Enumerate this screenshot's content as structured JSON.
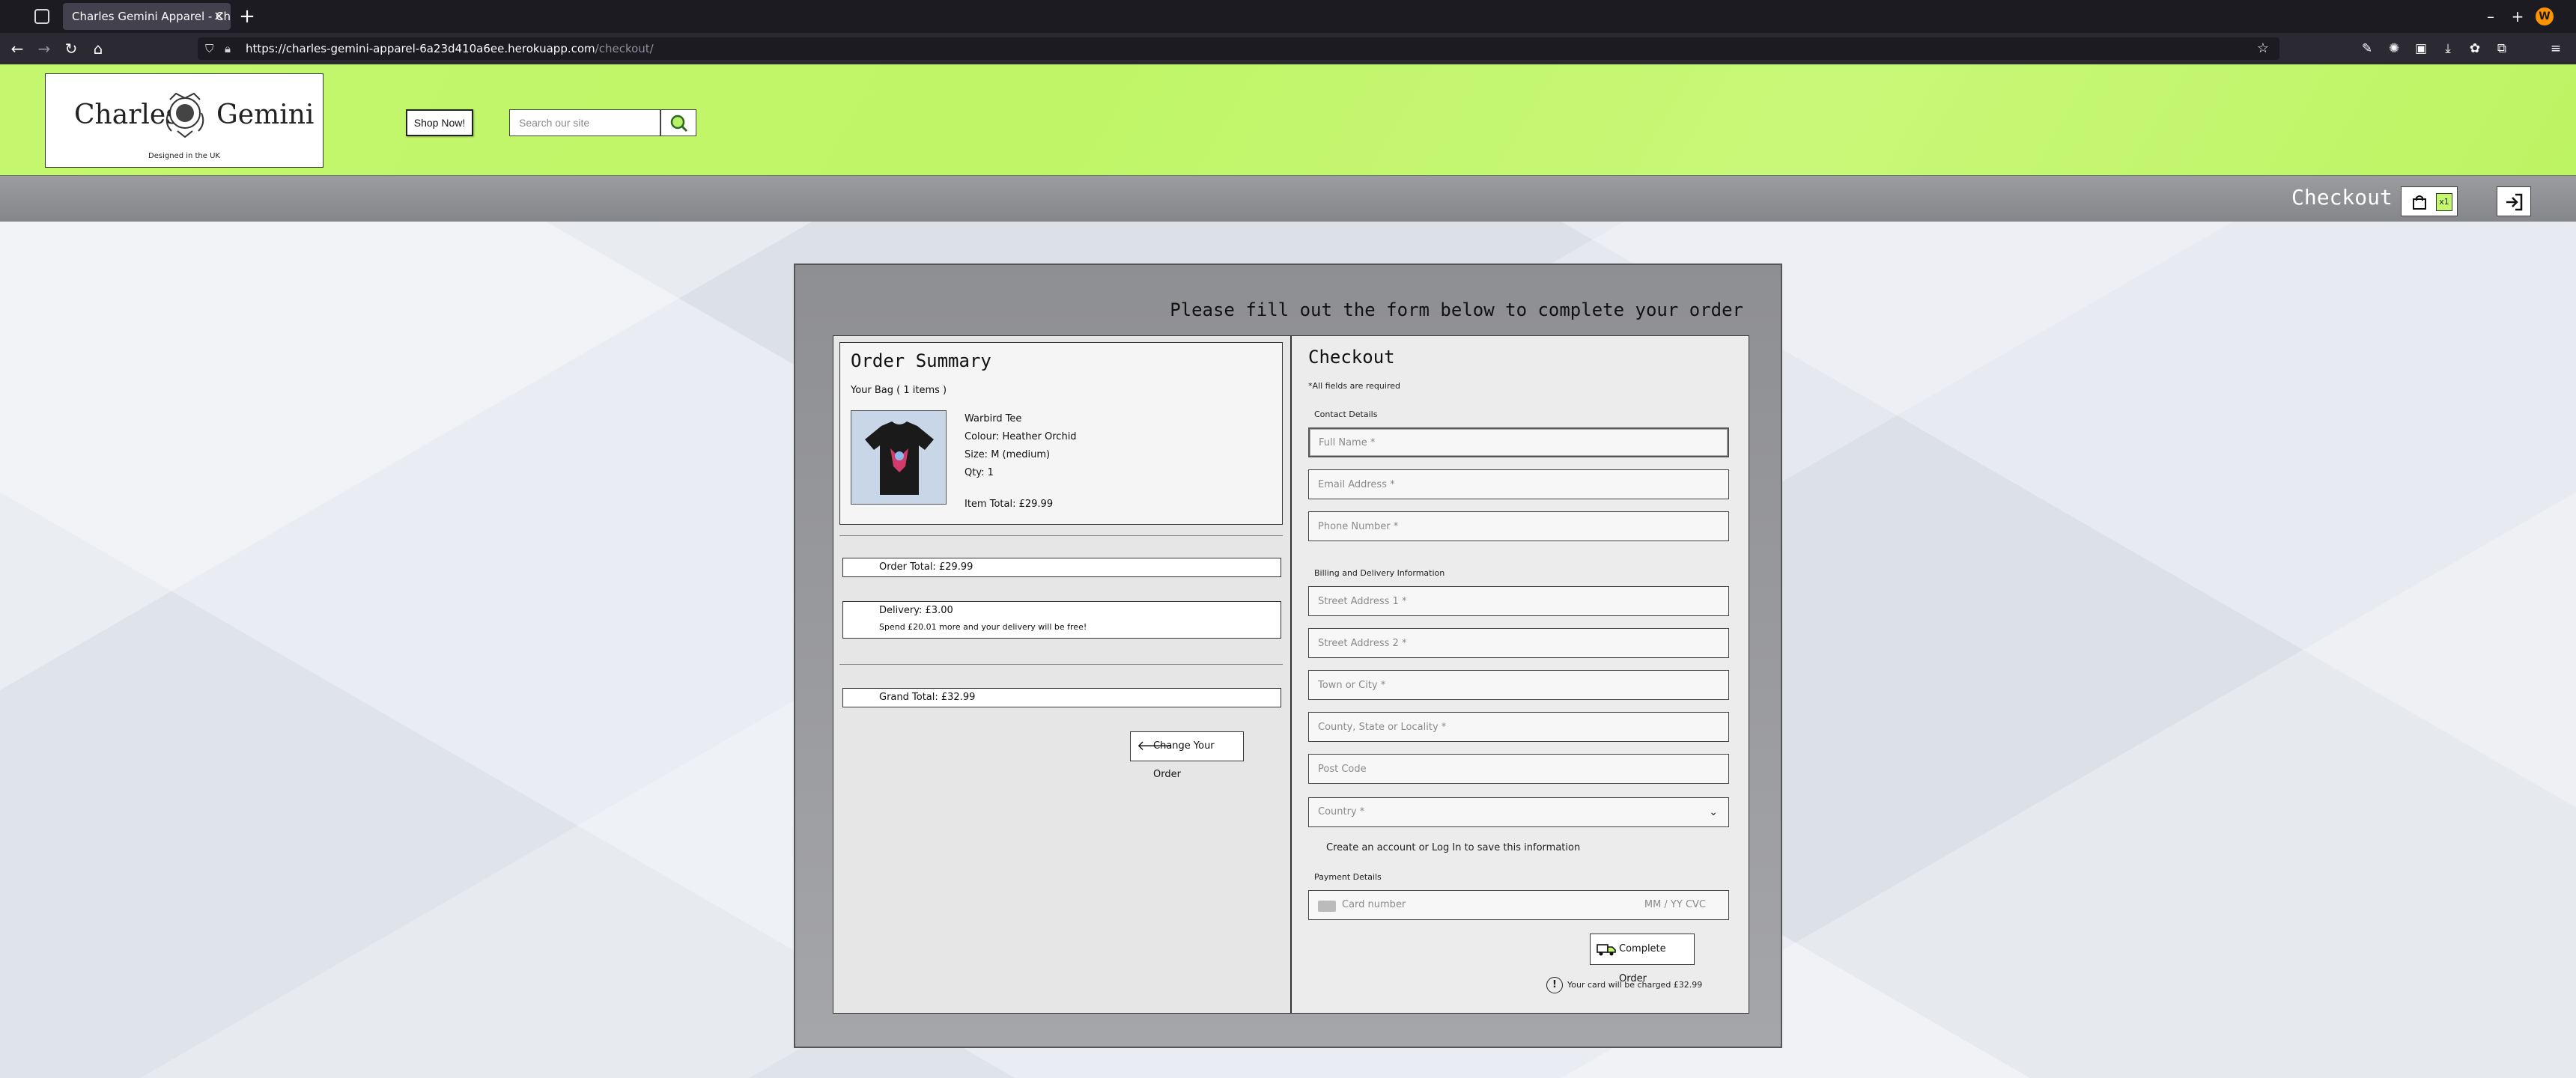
{
  "browser": {
    "tab_title": "Charles Gemini Apparel - Check",
    "tab_close": "×",
    "new_tab": "+",
    "url_host": "https://charles-gemini-apparel-6a23d410a6ee.herokuapp.com",
    "url_path": "/checkout/",
    "window_controls": [
      "–",
      "+",
      "×"
    ]
  },
  "header": {
    "brand_left": "Charles",
    "brand_right": "Gemini",
    "tagline": "Designed in the UK",
    "shop_now": "Shop Now!",
    "search_placeholder": "Search our site",
    "page_label": "Checkout",
    "bag_count": "x1"
  },
  "page": {
    "instruction": "Please fill out the form below to complete your order"
  },
  "order_summary": {
    "title": "Order Summary",
    "bag_count": "Your Bag ( 1 items )",
    "product": {
      "name": "Warbird Tee",
      "colour": "Colour: Heather Orchid",
      "size": "Size: M (medium)",
      "qty": "Qty: 1",
      "item_total": "Item Total: £29.99"
    },
    "order_total": "Order Total: £29.99",
    "delivery": "Delivery: £3.00",
    "delivery_note": "Spend £20.01 more and your delivery will be free!",
    "grand_total": "Grand Total: £32.99",
    "change_order": "Change Your Order"
  },
  "checkout": {
    "title": "Checkout",
    "required_note": "*All fields are required",
    "contact_heading": "Contact Details",
    "full_name": "Full Name *",
    "email": "Email Address *",
    "phone": "Phone Number *",
    "billing_heading": "Billing and Delivery Information",
    "street1": "Street Address 1 *",
    "street2": "Street Address 2 *",
    "town": "Town or City *",
    "county": "County, State or Locality *",
    "postcode": "Post Code",
    "country": "Country *",
    "account_note": "Create an account or Log In to save this information",
    "payment_heading": "Payment Details",
    "card_number": "Card number",
    "card_exp": "MM / YY  CVC",
    "complete_order": "Complete Order",
    "charge_note": "Your card will be charged £32.99"
  }
}
